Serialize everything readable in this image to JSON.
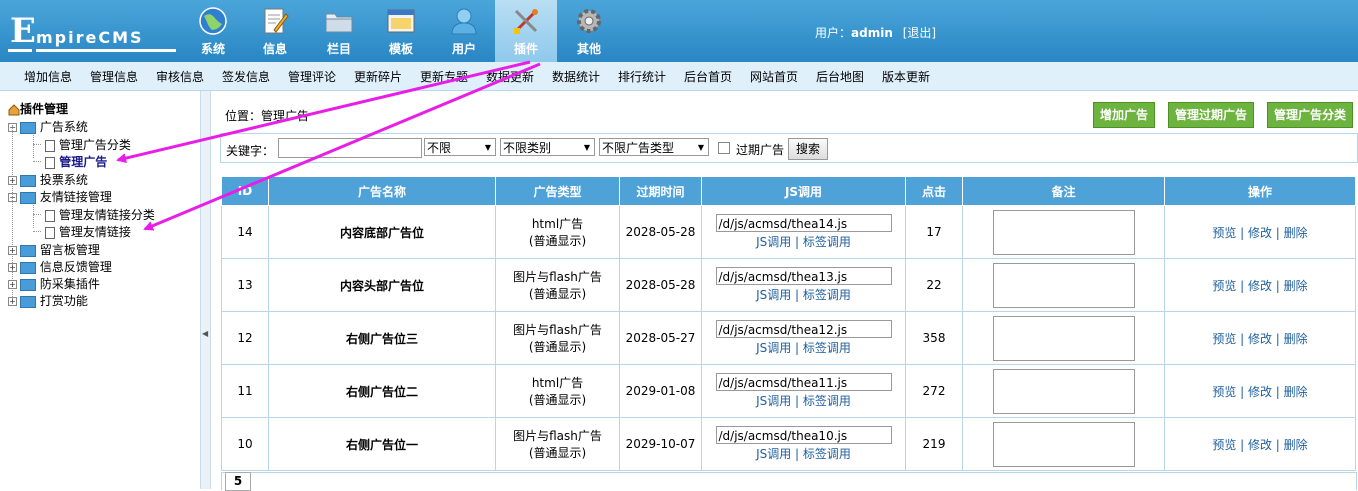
{
  "header": {
    "logo_big": "E",
    "logo_word": "mpireCMS",
    "nav": [
      {
        "label": "系统",
        "icon": "globe-icon"
      },
      {
        "label": "信息",
        "icon": "edit-note-icon"
      },
      {
        "label": "栏目",
        "icon": "folder-icon"
      },
      {
        "label": "模板",
        "icon": "window-template-icon"
      },
      {
        "label": "用户",
        "icon": "user-icon"
      },
      {
        "label": "插件",
        "icon": "tools-icon"
      },
      {
        "label": "其他",
        "icon": "gear-icon"
      }
    ],
    "active_nav": "插件",
    "user_prefix": "用户：",
    "username": "admin",
    "logout": "[退出]"
  },
  "submenu": [
    "增加信息",
    "管理信息",
    "审核信息",
    "签发信息",
    "管理评论",
    "更新碎片",
    "更新专题",
    "数据更新",
    "数据统计",
    "排行统计",
    "后台首页",
    "网站首页",
    "后台地图",
    "版本更新"
  ],
  "tree": {
    "root": "插件管理",
    "ad_system": "广告系统",
    "ad_category": "管理广告分类",
    "ad_manage": "管理广告",
    "vote": "投票系统",
    "links": "友情链接管理",
    "links_category": "管理友情链接分类",
    "links_manage": "管理友情链接",
    "guestbook": "留言板管理",
    "feedback": "信息反馈管理",
    "anticollect": "防采集插件",
    "reward": "打赏功能"
  },
  "main": {
    "position": "位置：管理广告",
    "buttons": {
      "add": "增加广告",
      "expired": "管理过期广告",
      "category": "管理广告分类"
    },
    "search": {
      "keyword_label": "关键字：",
      "keyword_value": "",
      "field": "不限",
      "category": "不限类别",
      "ad_type": "不限广告类型",
      "expired_label": "过期广告",
      "search_button": "搜索"
    },
    "table": {
      "headers": [
        "ID",
        "广告名称",
        "广告类型",
        "过期时间",
        "JS调用",
        "点击",
        "备注",
        "操作"
      ],
      "js_links": "JS调用 | 标签调用",
      "ops": "预览 | 修改 | 删除",
      "rows": [
        {
          "id": "14",
          "name": "内容底部广告位",
          "type1": "html广告",
          "type2": "(普通显示)",
          "expire": "2028-05-28",
          "js": "/d/js/acmsd/thea14.js",
          "clicks": "17"
        },
        {
          "id": "13",
          "name": "内容头部广告位",
          "type1": "图片与flash广告",
          "type2": "(普通显示)",
          "expire": "2028-05-28",
          "js": "/d/js/acmsd/thea13.js",
          "clicks": "22"
        },
        {
          "id": "12",
          "name": "右侧广告位三",
          "type1": "图片与flash广告",
          "type2": "(普通显示)",
          "expire": "2028-05-27",
          "js": "/d/js/acmsd/thea12.js",
          "clicks": "358"
        },
        {
          "id": "11",
          "name": "右侧广告位二",
          "type1": "html广告",
          "type2": "(普通显示)",
          "expire": "2029-01-08",
          "js": "/d/js/acmsd/thea11.js",
          "clicks": "272"
        },
        {
          "id": "10",
          "name": "右侧广告位一",
          "type1": "图片与flash广告",
          "type2": "(普通显示)",
          "expire": "2029-10-07",
          "js": "/d/js/acmsd/thea10.js",
          "clicks": "219"
        }
      ]
    },
    "pager": "5"
  },
  "colors": {
    "header": "#2a86c4",
    "active_tab": "#a8d6f0",
    "green_button": "#6db33f",
    "table_header": "#4fa2d8",
    "annotation_arrow": "#e81ee8"
  }
}
